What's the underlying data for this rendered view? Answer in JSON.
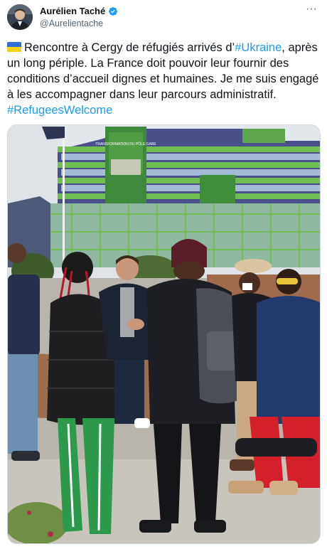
{
  "author": {
    "display_name": "Aurélien Taché",
    "handle": "@Aurelientache",
    "avatar_icon": "user-avatar",
    "verified_icon": "verified-badge-icon",
    "verified_color": "#1d9bf0"
  },
  "menu": {
    "more_label": "···",
    "more_icon": "more-options-icon"
  },
  "text": {
    "flag_icon": "ukraine-flag",
    "part1": "Rencontre à Cergy de réfugiés arrivés d’",
    "hashtag1": "#Ukraine",
    "part2": ", après un long périple. La France doit pouvoir leur fournir des conditions d’accueil dignes et humaines. Je me suis engagé à les accompagner dans leur parcours administratif. ",
    "hashtag2": "#RefugeesWelcome"
  },
  "media": {
    "sign_title": "TRANSFORMATION DU PÔLE GARE",
    "accent_color": "#1d9bf0"
  }
}
